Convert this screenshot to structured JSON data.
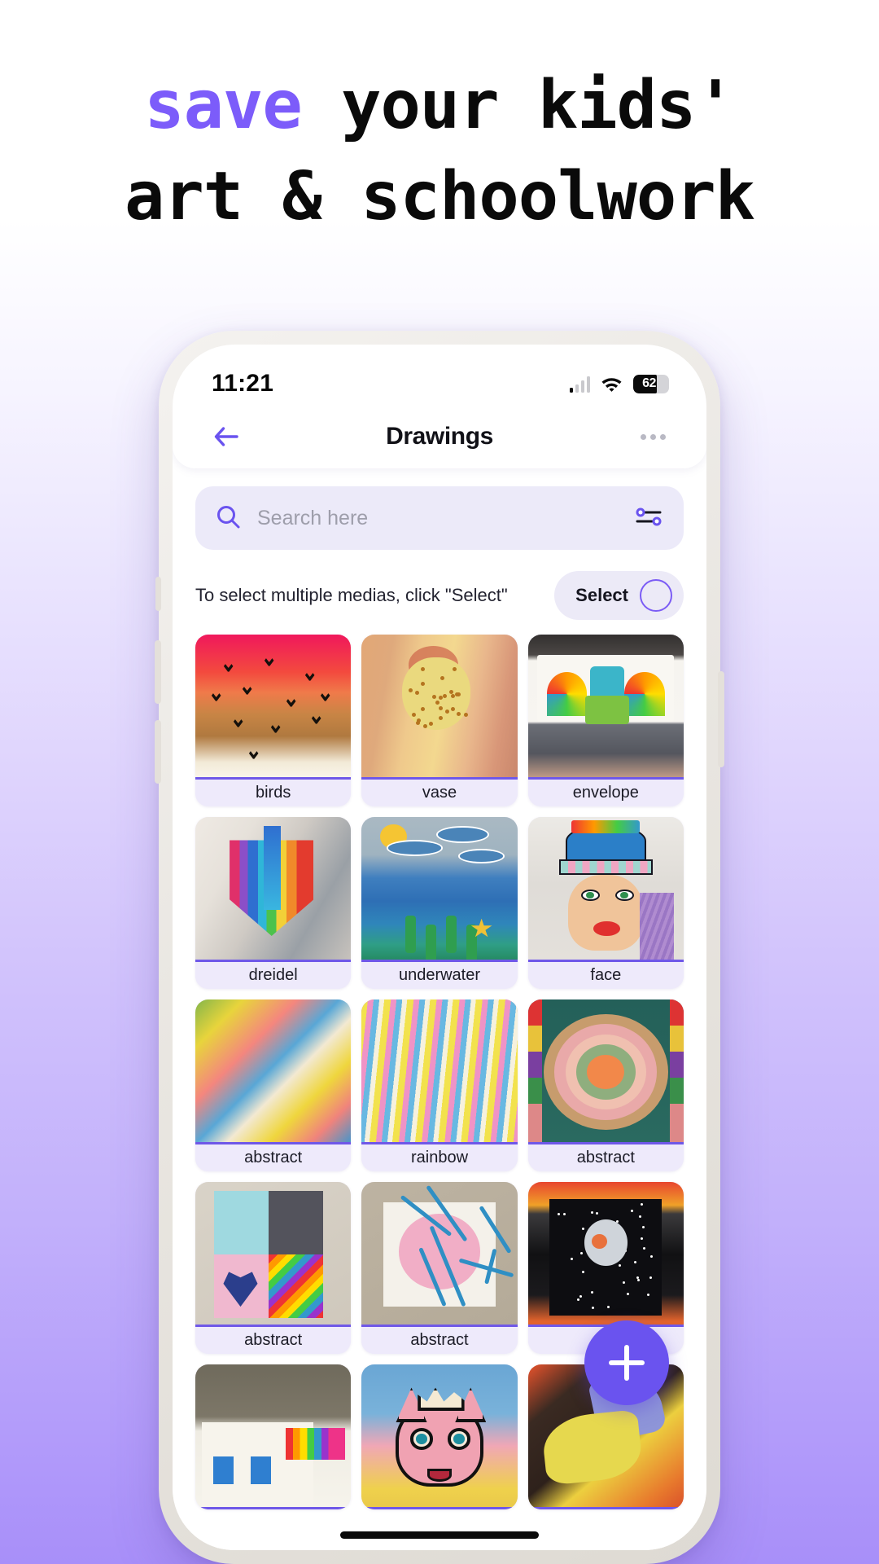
{
  "headline": {
    "line1_accent": "save",
    "line1_rest": " your kids'",
    "line2": "art & schoolwork",
    "accent_color": "#7c5cfa"
  },
  "phone": {
    "status": {
      "time": "11:21",
      "battery_percent": "62",
      "signal_icon": "cellular-signal-icon",
      "wifi_icon": "wifi-icon",
      "battery_icon": "battery-icon"
    },
    "nav": {
      "back_icon": "arrow-left-icon",
      "title": "Drawings",
      "more_icon": "more-horizontal-icon"
    },
    "search": {
      "placeholder": "Search here",
      "search_icon": "search-icon",
      "filter_icon": "sliders-filter-icon"
    },
    "select_row": {
      "hint": "To select multiple medias, click \"Select\"",
      "button_label": "Select",
      "circle_icon": "empty-circle-icon"
    },
    "fab": {
      "icon": "plus-icon",
      "color": "#6a53ef"
    },
    "gallery": [
      {
        "label": "birds",
        "art": "a-birds"
      },
      {
        "label": "vase",
        "art": "a-vase"
      },
      {
        "label": "envelope",
        "art": "a-env"
      },
      {
        "label": "dreidel",
        "art": "a-dreidel"
      },
      {
        "label": "underwater",
        "art": "a-under"
      },
      {
        "label": "face",
        "art": "a-face"
      },
      {
        "label": "abstract",
        "art": "a-marble"
      },
      {
        "label": "rainbow",
        "art": "a-rainbow"
      },
      {
        "label": "abstract",
        "art": "a-oval"
      },
      {
        "label": "abstract",
        "art": "a-hearts"
      },
      {
        "label": "abstract",
        "art": "a-scrib"
      },
      {
        "label": "",
        "art": "a-space"
      }
    ],
    "gallery_partial": [
      {
        "art": "a-house"
      },
      {
        "art": "a-cat"
      },
      {
        "art": "a-butterfly"
      }
    ]
  }
}
